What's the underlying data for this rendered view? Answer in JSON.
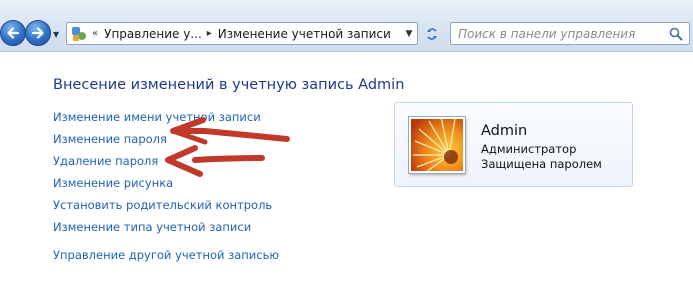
{
  "toolbar": {
    "back_icon": "arrow-left-icon",
    "forward_icon": "arrow-right-icon",
    "history_icon": "chevron-down-icon"
  },
  "address_bar": {
    "icon": "control-panel-icon",
    "overflow_glyph": "«",
    "separator_glyph": "▸",
    "breadcrumbs": [
      "Управление у...",
      "Изменение учетной записи"
    ],
    "dropdown_icon": "chevron-down-icon",
    "refresh_icon": "refresh-icon"
  },
  "search": {
    "placeholder": "Поиск в панели управления",
    "icon": "search-icon"
  },
  "main": {
    "title": "Внесение изменений в учетную запись Admin",
    "tasks": [
      "Изменение имени учетной записи",
      "Изменение пароля",
      "Удаление пароля",
      "Изменение рисунка",
      "Установить родительский контроль",
      "Изменение типа учетной записи"
    ],
    "other_account_link": "Управление другой учетной записью"
  },
  "account": {
    "name": "Admin",
    "role": "Администратор",
    "status": "Защищена паролем",
    "avatar_icon": "flower-avatar-icon"
  },
  "annotations": {
    "arrow_color": "#c0392b",
    "arrow_icon": "hand-drawn-arrow-icon"
  }
}
